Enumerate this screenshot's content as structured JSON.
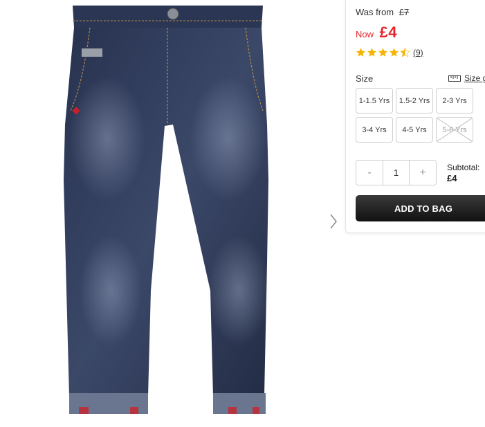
{
  "product": {
    "image_alt": "product-image-jeans",
    "was_label": "Was from",
    "was_price": "£7",
    "now_label": "Now",
    "now_price": "£4",
    "rating": 4.5,
    "review_count": "(9)"
  },
  "sizes": {
    "label": "Size",
    "guide_label": "Size g",
    "options": [
      {
        "label": "1-1.5 Yrs",
        "available": true
      },
      {
        "label": "1.5-2 Yrs",
        "available": true
      },
      {
        "label": "2-3 Yrs",
        "available": true
      },
      {
        "label": "3-4 Yrs",
        "available": true
      },
      {
        "label": "4-5 Yrs",
        "available": true
      },
      {
        "label": "5-6 Yrs",
        "available": false
      }
    ]
  },
  "quantity": {
    "minus": "-",
    "value": "1",
    "plus": "+"
  },
  "subtotal": {
    "label": "Subtotal:",
    "amount": "£4"
  },
  "cta": {
    "add_to_bag": "ADD TO BAG"
  },
  "colors": {
    "price_red": "#e4262b",
    "star_gold": "#f5b400",
    "button_dark": "#1c1c1c"
  },
  "icons": {
    "next": "chevron-right-icon",
    "size_guide": "ruler-icon",
    "star": "star-icon"
  }
}
